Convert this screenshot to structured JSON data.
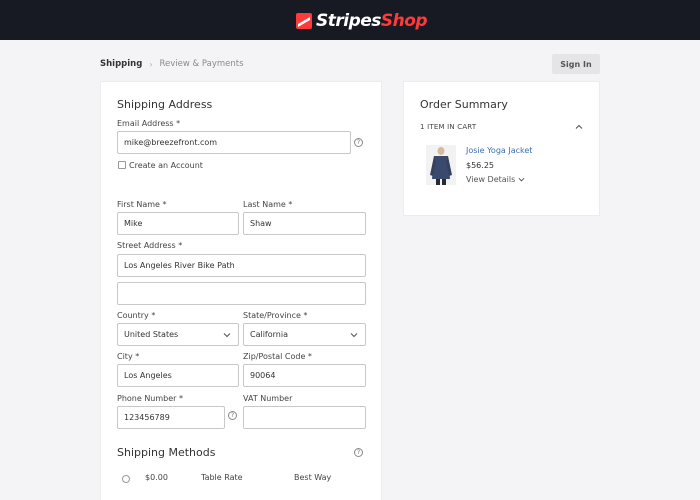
{
  "header": {
    "brand_part1": "Stripes",
    "brand_part2": "Shop",
    "brand_color": "#ff3a3a",
    "background": "#171a23"
  },
  "breadcrumb": {
    "steps": [
      "Shipping",
      "Review & Payments"
    ],
    "separator": "›"
  },
  "sign_in": {
    "label": "Sign In"
  },
  "shipping_address": {
    "title": "Shipping Address",
    "email": {
      "label": "Email Address *",
      "value": "mike@breezefront.com"
    },
    "create_account": {
      "label": "Create an Account",
      "checked": false
    },
    "first_name": {
      "label": "First Name *",
      "value": "Mike"
    },
    "last_name": {
      "label": "Last Name *",
      "value": "Shaw"
    },
    "street": {
      "label": "Street Address *",
      "line1": "Los Angeles River Bike Path",
      "line2": ""
    },
    "country": {
      "label": "Country *",
      "value": "United States"
    },
    "state": {
      "label": "State/Province *",
      "value": "California"
    },
    "city": {
      "label": "City *",
      "value": "Los Angeles"
    },
    "zip": {
      "label": "Zip/Postal Code *",
      "value": "90064"
    },
    "phone": {
      "label": "Phone Number *",
      "value": "123456789"
    },
    "vat": {
      "label": "VAT Number",
      "value": ""
    },
    "help_symbol": "?"
  },
  "shipping_methods": {
    "title": "Shipping Methods",
    "methods": [
      {
        "price": "$0.00",
        "method": "Table Rate",
        "carrier": "Best Way"
      }
    ]
  },
  "order_summary": {
    "title": "Order Summary",
    "items_count": "1 ITEM IN CART",
    "product": {
      "name": "Josie Yoga Jacket",
      "price": "$56.25",
      "details_label": "View Details"
    }
  },
  "icons": {
    "help": "help-circle-icon",
    "chevron": "chevron-down-icon",
    "chevron_up": "chevron-up-icon"
  }
}
